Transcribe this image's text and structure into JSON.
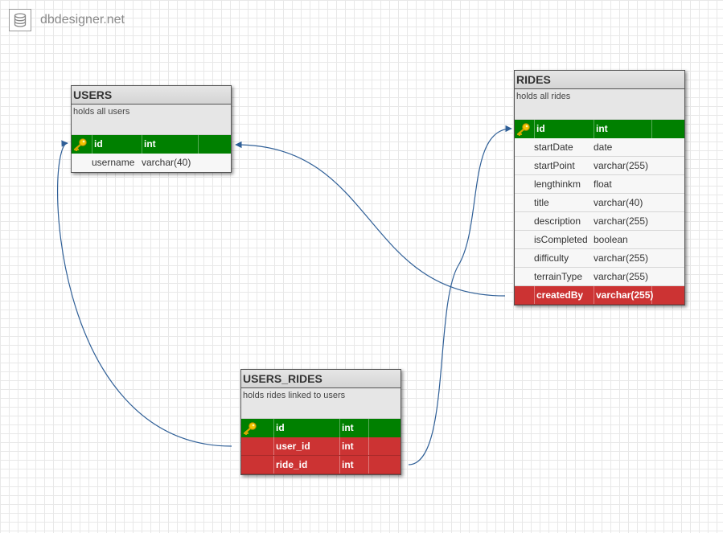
{
  "brand": {
    "text": "dbdesigner.net",
    "icon": "database-icon"
  },
  "colors": {
    "primary_key": "#008000",
    "foreign_key": "#cc3333",
    "link": "#2f5f97"
  },
  "tables": {
    "users": {
      "name": "USERS",
      "description": "holds all users",
      "fields": [
        {
          "name": "id",
          "type": "int",
          "kind": "pk"
        },
        {
          "name": "username",
          "type": "varchar(40)",
          "kind": "normal"
        }
      ]
    },
    "rides": {
      "name": "RIDES",
      "description": "holds all rides",
      "fields": [
        {
          "name": "id",
          "type": "int",
          "kind": "pk"
        },
        {
          "name": "startDate",
          "type": "date",
          "kind": "normal"
        },
        {
          "name": "startPoint",
          "type": "varchar(255)",
          "kind": "normal"
        },
        {
          "name": "lengthinkm",
          "type": "float",
          "kind": "normal"
        },
        {
          "name": "title",
          "type": "varchar(40)",
          "kind": "normal"
        },
        {
          "name": "description",
          "type": "varchar(255)",
          "kind": "normal"
        },
        {
          "name": "isCompleted",
          "type": "boolean",
          "kind": "normal"
        },
        {
          "name": "difficulty",
          "type": "varchar(255)",
          "kind": "normal"
        },
        {
          "name": "terrainType",
          "type": "varchar(255)",
          "kind": "normal"
        },
        {
          "name": "createdBy",
          "type": "varchar(255)",
          "kind": "fk"
        }
      ]
    },
    "users_rides": {
      "name": "USERS_RIDES",
      "description": "holds rides linked to users",
      "fields": [
        {
          "name": "id",
          "type": "int",
          "kind": "pk"
        },
        {
          "name": "user_id",
          "type": "int",
          "kind": "fk"
        },
        {
          "name": "ride_id",
          "type": "int",
          "kind": "fk"
        }
      ]
    }
  },
  "relationships": [
    {
      "from": "rides.createdBy",
      "to": "users.id"
    },
    {
      "from": "users_rides.user_id",
      "to": "users.id"
    },
    {
      "from": "users_rides.ride_id",
      "to": "rides.id"
    }
  ]
}
